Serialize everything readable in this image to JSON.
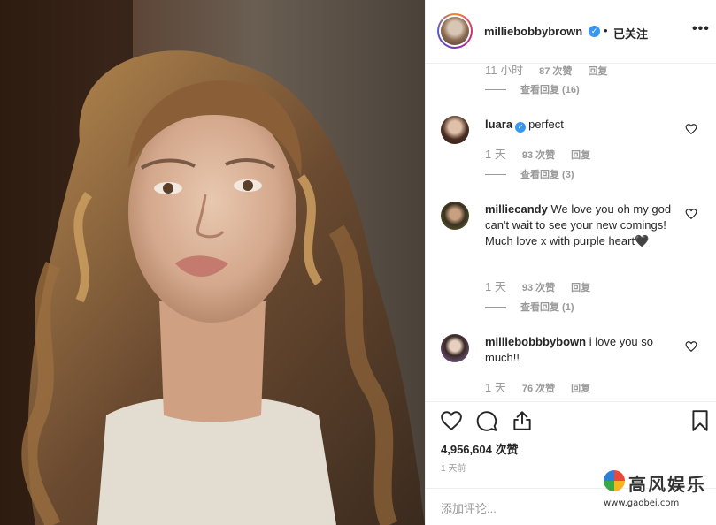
{
  "header": {
    "username": "milliebobbybrown",
    "separator": "•",
    "follow_status": "已关注",
    "more_label": "•••"
  },
  "comments": {
    "top_meta": {
      "time": "11 小时",
      "likes": "87 次赞",
      "reply": "回复"
    },
    "top_view_replies": "查看回复 (16)",
    "items": [
      {
        "username": "luara",
        "verified": true,
        "text": "perfect",
        "time": "1 天",
        "likes": "93 次赞",
        "reply": "回复",
        "view_replies": "查看回复 (3)"
      },
      {
        "username": "milliecandy",
        "verified": false,
        "text": "We love you oh my god can't wait to see your new comings! Much love x with purple heart🖤",
        "time": "1 天",
        "likes": "93 次赞",
        "reply": "回复",
        "view_replies": "查看回复 (1)"
      },
      {
        "username": "milliebobbbybown",
        "verified": false,
        "text": "i love you so much!!",
        "time": "1 天",
        "likes": "76 次赞",
        "reply": "回复"
      }
    ]
  },
  "actions": {
    "likes_count": "4,956,604 次赞",
    "post_time": "1 天前",
    "comment_placeholder": "添加评论..."
  },
  "watermark": {
    "title": "高风娱乐",
    "url": "www.gaobei.com"
  },
  "icons": {
    "verified": "verified-badge-icon",
    "like": "heart-icon",
    "comment": "comment-bubble-icon",
    "share": "share-icon",
    "save": "bookmark-icon",
    "more": "more-options-icon"
  },
  "colors": {
    "verified_blue": "#3897f0",
    "muted_text": "#999999",
    "text": "#262626",
    "divider": "#efefef"
  }
}
